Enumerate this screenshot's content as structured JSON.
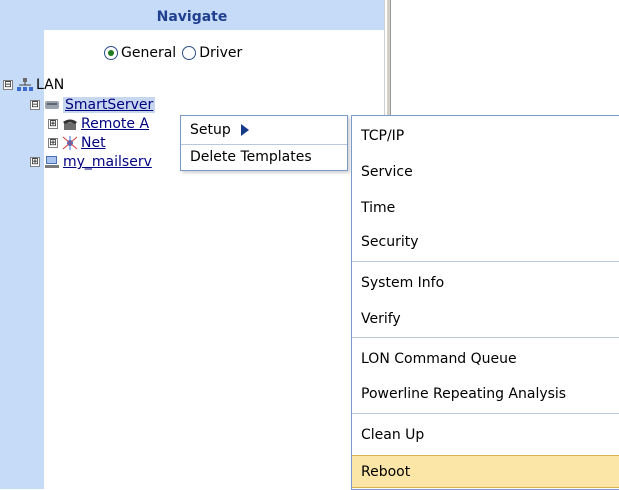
{
  "navigate": {
    "header": "Navigate",
    "view_options": [
      {
        "label": "General",
        "checked": true
      },
      {
        "label": "Driver",
        "checked": false
      }
    ],
    "tree": {
      "root": {
        "label": "LAN",
        "expander": "⊟"
      },
      "server": {
        "label": "SmartServer",
        "expander": "⊟"
      },
      "children": [
        {
          "label": "Remote A",
          "expander": "⊞",
          "icon": "phone-icon"
        },
        {
          "label": "Net",
          "expander": "⊞",
          "icon": "network-icon"
        }
      ],
      "sibling": {
        "label": "my_mailserv",
        "expander": "⊞",
        "icon": "computer-icon"
      }
    }
  },
  "context_menu": {
    "items": [
      "Setup",
      "Delete Templates"
    ]
  },
  "setup_submenu": {
    "items": [
      "TCP/IP",
      "Service",
      "Time",
      "Security",
      "System Info",
      "Verify",
      "LON Command Queue",
      "Powerline Repeating Analysis",
      "Clean Up",
      "Reboot"
    ],
    "highlighted": "Reboot"
  },
  "colors": {
    "nav_background": "#c6dbf7",
    "header_text": "#1f3f8f",
    "highlight": "#fbe6a7",
    "menu_border": "#7a9bc9"
  }
}
